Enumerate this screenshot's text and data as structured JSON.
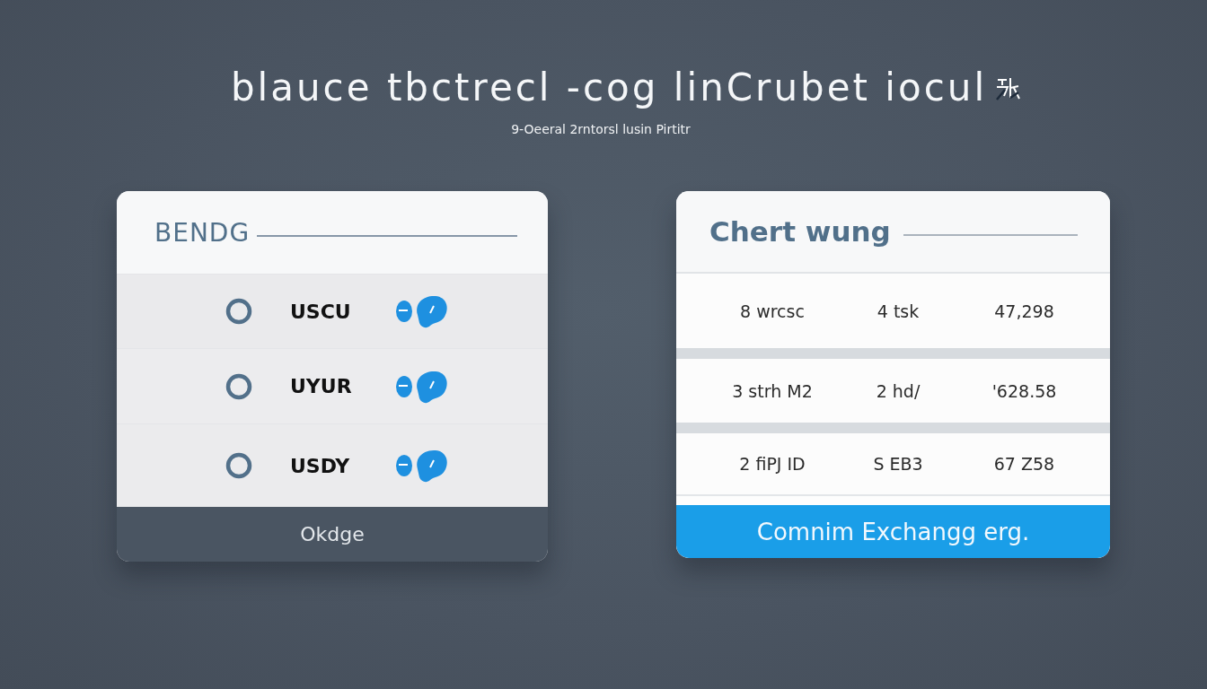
{
  "header": {
    "title": "blauce tbctrecl -cog linCrubet iocul",
    "subtitle": "9-Oeeral 2rntorsl lusin Pirtitr"
  },
  "currency_card": {
    "heading": "BENDG",
    "rows": [
      {
        "code": "USCU"
      },
      {
        "code": "UYUR"
      },
      {
        "code": "USDY"
      }
    ],
    "button": "Okdge"
  },
  "rates_card": {
    "heading": "Chert wung",
    "rows": [
      {
        "cells": [
          "8 wrcsc",
          "4 tsk",
          "47,298"
        ]
      },
      {
        "cells": [
          "3 strh M2",
          "2 hd/",
          "'628.58"
        ]
      },
      {
        "cells": [
          "2 fiPJ ID",
          "S EB3",
          "67 Z58"
        ]
      }
    ],
    "button": "Comnim Exchangg erg."
  }
}
